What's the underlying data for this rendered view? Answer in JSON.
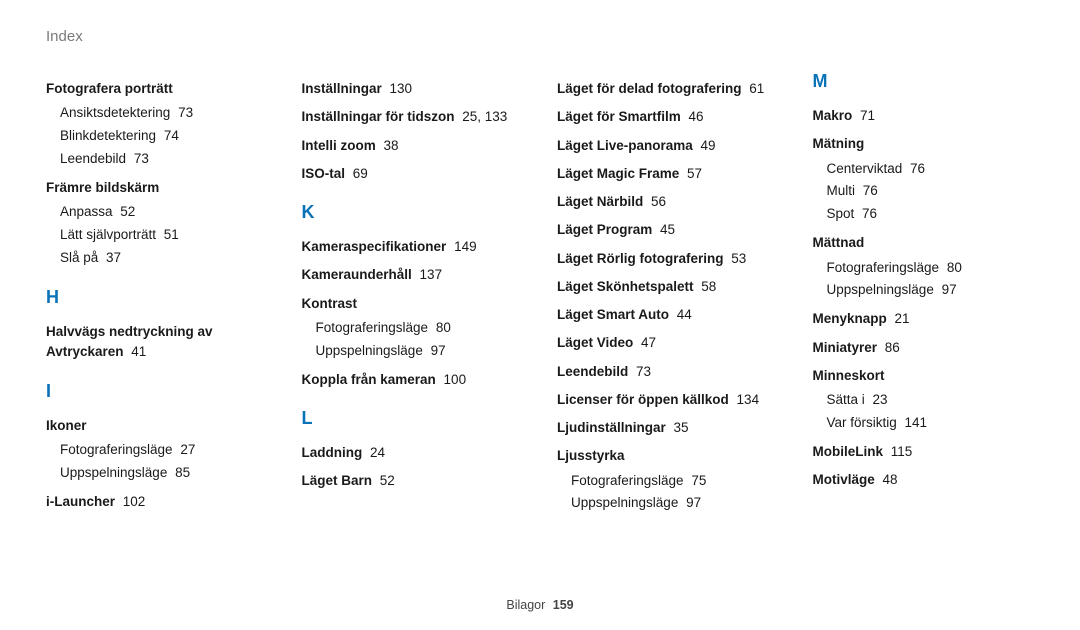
{
  "header": "Index",
  "footer": {
    "label": "Bilagor",
    "page": "159"
  },
  "columns": [
    {
      "groups": [
        {
          "letter": null,
          "items": [
            {
              "label": "Fotografera porträtt",
              "page": "",
              "subs": [
                {
                  "label": "Ansiktsdetektering",
                  "page": "73"
                },
                {
                  "label": "Blinkdetektering",
                  "page": "74"
                },
                {
                  "label": "Leendebild",
                  "page": "73"
                }
              ]
            },
            {
              "label": "Främre bildskärm",
              "page": "",
              "subs": [
                {
                  "label": "Anpassa",
                  "page": "52"
                },
                {
                  "label": "Lätt självporträtt",
                  "page": "51"
                },
                {
                  "label": "Slå på",
                  "page": "37"
                }
              ]
            }
          ]
        },
        {
          "letter": "H",
          "items": [
            {
              "label": "Halvvägs nedtryckning av Avtryckaren",
              "page": "41",
              "subs": []
            }
          ]
        },
        {
          "letter": "I",
          "items": [
            {
              "label": "Ikoner",
              "page": "",
              "subs": [
                {
                  "label": "Fotograferingsläge",
                  "page": "27"
                },
                {
                  "label": "Uppspelningsläge",
                  "page": "85"
                }
              ]
            },
            {
              "label": "i-Launcher",
              "page": "102",
              "subs": []
            }
          ]
        }
      ]
    },
    {
      "groups": [
        {
          "letter": null,
          "items": [
            {
              "label": "Inställningar",
              "page": "130",
              "subs": []
            },
            {
              "label": "Inställningar för tidszon",
              "page": "25, 133",
              "subs": []
            },
            {
              "label": "Intelli zoom",
              "page": "38",
              "subs": []
            },
            {
              "label": "ISO-tal",
              "page": "69",
              "subs": []
            }
          ]
        },
        {
          "letter": "K",
          "items": [
            {
              "label": "Kameraspecifikationer",
              "page": "149",
              "subs": []
            },
            {
              "label": "Kameraunderhåll",
              "page": "137",
              "subs": []
            },
            {
              "label": "Kontrast",
              "page": "",
              "subs": [
                {
                  "label": "Fotograferingsläge",
                  "page": "80"
                },
                {
                  "label": "Uppspelningsläge",
                  "page": "97"
                }
              ]
            },
            {
              "label": "Koppla från kameran",
              "page": "100",
              "subs": []
            }
          ]
        },
        {
          "letter": "L",
          "items": [
            {
              "label": "Laddning",
              "page": "24",
              "subs": []
            },
            {
              "label": "Läget Barn",
              "page": "52",
              "subs": []
            }
          ]
        }
      ]
    },
    {
      "groups": [
        {
          "letter": null,
          "items": [
            {
              "label": "Läget för delad fotografering",
              "page": "61",
              "subs": []
            },
            {
              "label": "Läget för Smartfilm",
              "page": "46",
              "subs": []
            },
            {
              "label": "Läget Live-panorama",
              "page": "49",
              "subs": []
            },
            {
              "label": "Läget Magic Frame",
              "page": "57",
              "subs": []
            },
            {
              "label": "Läget Närbild",
              "page": "56",
              "subs": []
            },
            {
              "label": "Läget Program",
              "page": "45",
              "subs": []
            },
            {
              "label": "Läget Rörlig fotografering",
              "page": "53",
              "subs": []
            },
            {
              "label": "Läget Skönhetspalett",
              "page": "58",
              "subs": []
            },
            {
              "label": "Läget Smart Auto",
              "page": "44",
              "subs": []
            },
            {
              "label": "Läget Video",
              "page": "47",
              "subs": []
            },
            {
              "label": "Leendebild",
              "page": "73",
              "subs": []
            },
            {
              "label": "Licenser för öppen källkod",
              "page": "134",
              "subs": []
            },
            {
              "label": "Ljudinställningar",
              "page": "35",
              "subs": []
            },
            {
              "label": "Ljusstyrka",
              "page": "",
              "subs": [
                {
                  "label": "Fotograferingsläge",
                  "page": "75"
                },
                {
                  "label": "Uppspelningsläge",
                  "page": "97"
                }
              ]
            }
          ]
        }
      ]
    },
    {
      "groups": [
        {
          "letter": "M",
          "items": [
            {
              "label": "Makro",
              "page": "71",
              "subs": []
            },
            {
              "label": "Mätning",
              "page": "",
              "subs": [
                {
                  "label": "Centerviktad",
                  "page": "76"
                },
                {
                  "label": "Multi",
                  "page": "76"
                },
                {
                  "label": "Spot",
                  "page": "76"
                }
              ]
            },
            {
              "label": "Mättnad",
              "page": "",
              "subs": [
                {
                  "label": "Fotograferingsläge",
                  "page": "80"
                },
                {
                  "label": "Uppspelningsläge",
                  "page": "97"
                }
              ]
            },
            {
              "label": "Menyknapp",
              "page": "21",
              "subs": []
            },
            {
              "label": "Miniatyrer",
              "page": "86",
              "subs": []
            },
            {
              "label": "Minneskort",
              "page": "",
              "subs": [
                {
                  "label": "Sätta i",
                  "page": "23"
                },
                {
                  "label": "Var försiktig",
                  "page": "141"
                }
              ]
            },
            {
              "label": "MobileLink",
              "page": "115",
              "subs": []
            },
            {
              "label": "Motivläge",
              "page": "48",
              "subs": []
            }
          ]
        }
      ]
    }
  ]
}
